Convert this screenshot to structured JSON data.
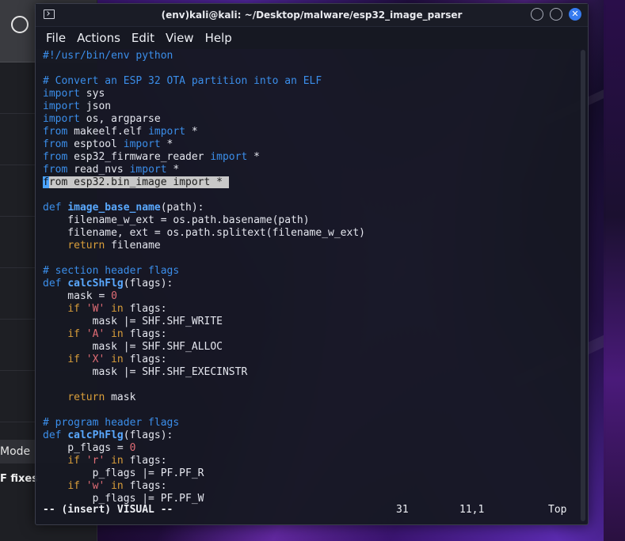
{
  "left_app": {
    "mode_label": "Mode",
    "fixes_label": "F fixes"
  },
  "terminal": {
    "title": "(env)kali@kali: ~/Desktop/malware/esp32_image_parser",
    "menu": [
      "File",
      "Actions",
      "Edit",
      "View",
      "Help"
    ],
    "code_lines": [
      [
        {
          "t": "#!/usr/bin/env python",
          "c": "comment"
        }
      ],
      [],
      [
        {
          "t": "# Convert an ESP 32 OTA partition into an ELF",
          "c": "comment"
        }
      ],
      [
        {
          "t": "import",
          "c": "kw"
        },
        {
          "t": " sys",
          "c": ""
        }
      ],
      [
        {
          "t": "import",
          "c": "kw"
        },
        {
          "t": " json",
          "c": ""
        }
      ],
      [
        {
          "t": "import",
          "c": "kw"
        },
        {
          "t": " os, argparse",
          "c": ""
        }
      ],
      [
        {
          "t": "from",
          "c": "kw"
        },
        {
          "t": " makeelf.elf ",
          "c": ""
        },
        {
          "t": "import",
          "c": "kw"
        },
        {
          "t": " *",
          "c": ""
        }
      ],
      [
        {
          "t": "from",
          "c": "kw"
        },
        {
          "t": " esptool ",
          "c": ""
        },
        {
          "t": "import",
          "c": "kw"
        },
        {
          "t": " *",
          "c": ""
        }
      ],
      [
        {
          "t": "from",
          "c": "kw"
        },
        {
          "t": " esp32_firmware_reader ",
          "c": ""
        },
        {
          "t": "import",
          "c": "kw"
        },
        {
          "t": " *",
          "c": ""
        }
      ],
      [
        {
          "t": "from",
          "c": "kw"
        },
        {
          "t": " read_nvs ",
          "c": ""
        },
        {
          "t": "import",
          "c": "kw"
        },
        {
          "t": " *",
          "c": ""
        }
      ],
      [
        {
          "t": "f",
          "c": "cursor-c"
        },
        {
          "t": "rom esp32.bin_image import * ",
          "c": "sel"
        }
      ],
      [],
      [
        {
          "t": "def",
          "c": "kw"
        },
        {
          "t": " ",
          "c": ""
        },
        {
          "t": "image_base_name",
          "c": "fn"
        },
        {
          "t": "(path):",
          "c": ""
        }
      ],
      [
        {
          "t": "    filename_w_ext = os.path.basename(path)",
          "c": ""
        }
      ],
      [
        {
          "t": "    filename, ext = os.path.splitext(filename_w_ext)",
          "c": ""
        }
      ],
      [
        {
          "t": "    ",
          "c": ""
        },
        {
          "t": "return",
          "c": "ret"
        },
        {
          "t": " filename",
          "c": ""
        }
      ],
      [],
      [
        {
          "t": "# section header flags",
          "c": "comment"
        }
      ],
      [
        {
          "t": "def",
          "c": "kw"
        },
        {
          "t": " ",
          "c": ""
        },
        {
          "t": "calcShFlg",
          "c": "fn"
        },
        {
          "t": "(flags):",
          "c": ""
        }
      ],
      [
        {
          "t": "    mask = ",
          "c": ""
        },
        {
          "t": "0",
          "c": "num"
        }
      ],
      [
        {
          "t": "    ",
          "c": ""
        },
        {
          "t": "if",
          "c": "ret"
        },
        {
          "t": " ",
          "c": ""
        },
        {
          "t": "'W'",
          "c": "str"
        },
        {
          "t": " ",
          "c": ""
        },
        {
          "t": "in",
          "c": "ret"
        },
        {
          "t": " flags:",
          "c": ""
        }
      ],
      [
        {
          "t": "        mask |= SHF.SHF_WRITE",
          "c": ""
        }
      ],
      [
        {
          "t": "    ",
          "c": ""
        },
        {
          "t": "if",
          "c": "ret"
        },
        {
          "t": " ",
          "c": ""
        },
        {
          "t": "'A'",
          "c": "str"
        },
        {
          "t": " ",
          "c": ""
        },
        {
          "t": "in",
          "c": "ret"
        },
        {
          "t": " flags:",
          "c": ""
        }
      ],
      [
        {
          "t": "        mask |= SHF.SHF_ALLOC",
          "c": ""
        }
      ],
      [
        {
          "t": "    ",
          "c": ""
        },
        {
          "t": "if",
          "c": "ret"
        },
        {
          "t": " ",
          "c": ""
        },
        {
          "t": "'X'",
          "c": "str"
        },
        {
          "t": " ",
          "c": ""
        },
        {
          "t": "in",
          "c": "ret"
        },
        {
          "t": " flags:",
          "c": ""
        }
      ],
      [
        {
          "t": "        mask |= SHF.SHF_EXECINSTR",
          "c": ""
        }
      ],
      [],
      [
        {
          "t": "    ",
          "c": ""
        },
        {
          "t": "return",
          "c": "ret"
        },
        {
          "t": " mask",
          "c": ""
        }
      ],
      [],
      [
        {
          "t": "# program header flags",
          "c": "comment"
        }
      ],
      [
        {
          "t": "def",
          "c": "kw"
        },
        {
          "t": " ",
          "c": ""
        },
        {
          "t": "calcPhFlg",
          "c": "fn"
        },
        {
          "t": "(flags):",
          "c": ""
        }
      ],
      [
        {
          "t": "    p_flags = ",
          "c": ""
        },
        {
          "t": "0",
          "c": "num"
        }
      ],
      [
        {
          "t": "    ",
          "c": ""
        },
        {
          "t": "if",
          "c": "ret"
        },
        {
          "t": " ",
          "c": ""
        },
        {
          "t": "'r'",
          "c": "str"
        },
        {
          "t": " ",
          "c": ""
        },
        {
          "t": "in",
          "c": "ret"
        },
        {
          "t": " flags:",
          "c": ""
        }
      ],
      [
        {
          "t": "        p_flags |= PF.PF_R",
          "c": ""
        }
      ],
      [
        {
          "t": "    ",
          "c": ""
        },
        {
          "t": "if",
          "c": "ret"
        },
        {
          "t": " ",
          "c": ""
        },
        {
          "t": "'w'",
          "c": "str"
        },
        {
          "t": " ",
          "c": ""
        },
        {
          "t": "in",
          "c": "ret"
        },
        {
          "t": " flags:",
          "c": ""
        }
      ],
      [
        {
          "t": "        p_flags |= PF.PF_W",
          "c": ""
        }
      ]
    ],
    "status": {
      "mode": "-- (insert) VISUAL --",
      "selected_count": "31",
      "line_col": "11,1",
      "scroll_pos": "Top"
    }
  }
}
